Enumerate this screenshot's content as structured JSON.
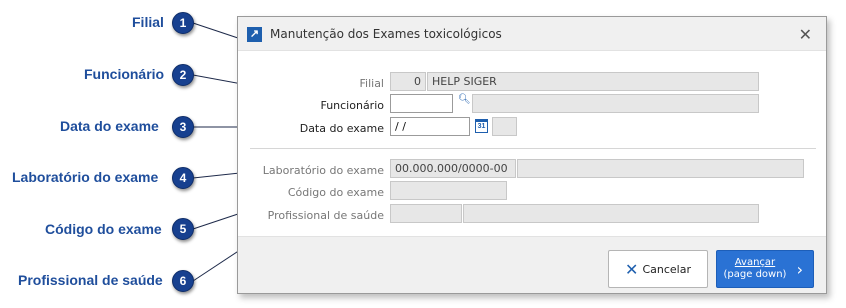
{
  "callouts": [
    {
      "label": "Filial",
      "number": "1"
    },
    {
      "label": "Funcionário",
      "number": "2"
    },
    {
      "label": "Data do exame",
      "number": "3"
    },
    {
      "label": "Laboratório do exame",
      "number": "4"
    },
    {
      "label": "Código do exame",
      "number": "5"
    },
    {
      "label": "Profissional de saúde",
      "number": "6"
    }
  ],
  "dialog": {
    "title": "Manutenção dos Exames toxicológicos",
    "close_glyph": "✕",
    "app_icon_glyph": "↗",
    "fields": {
      "filial": {
        "label": "Filial",
        "code": "0",
        "name": "HELP SIGER"
      },
      "funcionario": {
        "label": "Funcionário",
        "code": "",
        "name": ""
      },
      "data_exame": {
        "label": "Data do exame",
        "value": " / /",
        "extra": ""
      },
      "laboratorio": {
        "label": "Laboratório do exame",
        "cnpj": "00.000.000/0000-00",
        "name": ""
      },
      "codigo": {
        "label": "Código do exame",
        "value": ""
      },
      "profissional": {
        "label": "Profissional de saúde",
        "code": "",
        "name": ""
      }
    },
    "icons": {
      "lookup": "search-icon",
      "calendar": "calendar-icon",
      "calendar_text": "31"
    },
    "buttons": {
      "cancel_label": "Cancelar",
      "next_line1": "Avançar",
      "next_line2": "(page down)"
    }
  },
  "colors": {
    "callout_badge": "#17408f",
    "callout_text": "#1f4e9c",
    "primary_button": "#2a72d4"
  }
}
